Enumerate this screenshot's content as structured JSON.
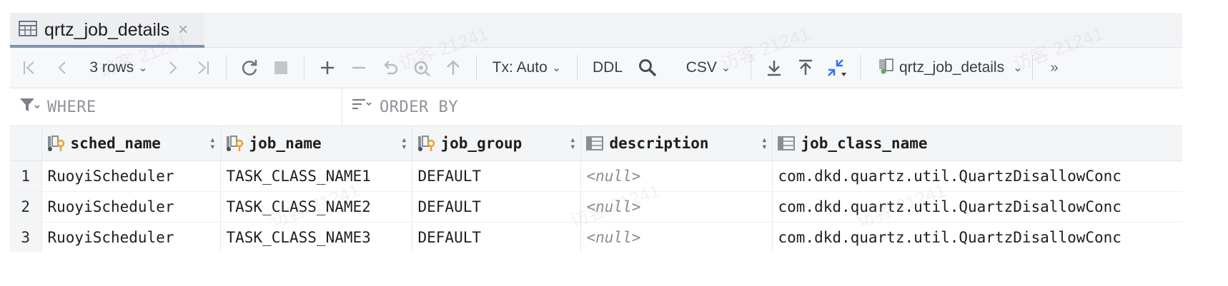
{
  "tab": {
    "title": "qrtz_job_details",
    "close": "×"
  },
  "toolbar": {
    "rows_label": "3 rows",
    "tx_label": "Tx: Auto",
    "ddl_label": "DDL",
    "export_format": "CSV",
    "datasource_label": "qrtz_job_details",
    "more": "»"
  },
  "filter": {
    "where_label": "WHERE",
    "orderby_label": "ORDER BY"
  },
  "columns": [
    {
      "name": "sched_name",
      "key": true,
      "sortable": true
    },
    {
      "name": "job_name",
      "key": true,
      "sortable": true
    },
    {
      "name": "job_group",
      "key": true,
      "sortable": true
    },
    {
      "name": "description",
      "key": false,
      "sortable": true
    },
    {
      "name": "job_class_name",
      "key": false,
      "sortable": false
    }
  ],
  "rows": [
    {
      "num": "1",
      "cells": [
        "RuoyiScheduler",
        "TASK_CLASS_NAME1",
        "DEFAULT",
        "<null>",
        "com.dkd.quartz.util.QuartzDisallowConc"
      ]
    },
    {
      "num": "2",
      "cells": [
        "RuoyiScheduler",
        "TASK_CLASS_NAME2",
        "DEFAULT",
        "<null>",
        "com.dkd.quartz.util.QuartzDisallowConc"
      ]
    },
    {
      "num": "3",
      "cells": [
        "RuoyiScheduler",
        "TASK_CLASS_NAME3",
        "DEFAULT",
        "<null>",
        "com.dkd.quartz.util.QuartzDisallowConc"
      ]
    }
  ],
  "watermark_text": "访客 21241"
}
